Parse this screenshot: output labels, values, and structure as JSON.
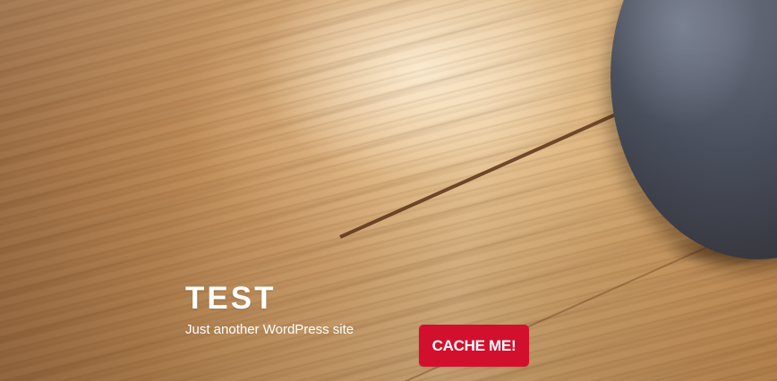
{
  "site": {
    "title": "TEST",
    "description": "Just another WordPress site"
  },
  "header_image": {
    "alt": ""
  },
  "cache_button": {
    "label": "CACHE ME!"
  },
  "colors": {
    "button_background": "#d2102e",
    "text": "#ffffff",
    "wood_floor": "#c89a62",
    "speaker": "#454a57"
  }
}
